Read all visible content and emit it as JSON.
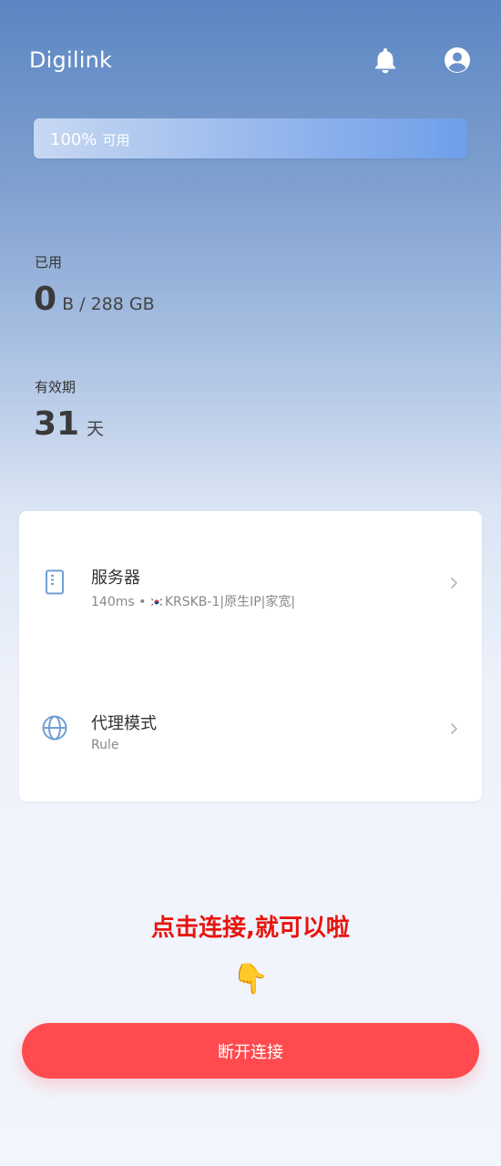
{
  "app": {
    "title": "Digilink"
  },
  "header": {
    "bell_icon": "bell-icon",
    "account_icon": "account-circle-icon"
  },
  "quota": {
    "percent_label": "100%",
    "available_label": "可用",
    "remaining_fraction": 1.0,
    "bar_color": "#7aa6ea"
  },
  "usage": {
    "label": "已用",
    "value": "0",
    "unit_total": "B / 288 GB"
  },
  "validity": {
    "label": "有效期",
    "value": "31",
    "unit": "天"
  },
  "server": {
    "title": "服务器",
    "latency": "140ms",
    "separator": "•",
    "flag": "KR",
    "node": "KRSKB-1|原生IP|家宽|",
    "icon": "server-icon"
  },
  "proxy_mode": {
    "title": "代理模式",
    "value": "Rule",
    "icon": "globe-icon"
  },
  "hint": {
    "text": "点击连接,就可以啦",
    "emoji": "👇"
  },
  "connect_button": {
    "label": "断开连接",
    "color": "#ff4b4f"
  }
}
